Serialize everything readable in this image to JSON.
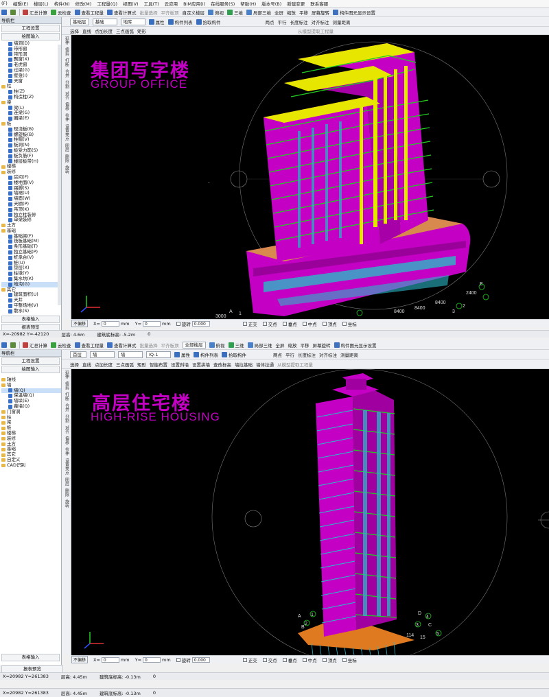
{
  "menu": [
    "(F)",
    "编辑(E)",
    "楼层(L)",
    "构件(N)",
    "修改(M)",
    "工程量(Q)",
    "视图(V)",
    "工具(T)",
    "云应用",
    "BIM应用(I)",
    "在线服务(S)",
    "帮助(H)",
    "版本号(B)",
    "新建变更",
    "联系客服"
  ],
  "panel1": {
    "toolbar1": {
      "calc": "汇总计算",
      "cloud": "云检查",
      "view_qty": "查看工程量",
      "view_formula": "查看计算式",
      "batch": "批量选择",
      "flat": "平齐板顶",
      "custom_floor": "自定义楼层",
      "top_view": "俯视",
      "three_d": "三维",
      "local3d": "局部三维",
      "full_screen": "全屏",
      "zoom": "缩放",
      "pan": "平移",
      "rotate": "屏幕旋转",
      "display": "构件图元显示设置"
    },
    "toolbar2": {
      "floor_label": "基础层",
      "floor_value": "基础",
      "type_value": "地库",
      "attr": "属性",
      "list": "构件列表",
      "pick": "拾取构件",
      "two_point": "两点",
      "parallel": "平行",
      "dim": "长度标注",
      "align": "对齐标注",
      "measure": "测量距离"
    },
    "toolbar3": {
      "select": "选择",
      "line": "直线",
      "add_len": "点加长度",
      "arc": "三点画弧",
      "rect": "矩形",
      "extract": "从模型提取工程量"
    },
    "sidebar": {
      "header": "导航栏",
      "btn1": "工程设置",
      "btn2": "绘图输入",
      "items": [
        {
          "label": "墙洞(D)",
          "lvl": 1
        },
        {
          "label": "带形窗",
          "lvl": 1
        },
        {
          "label": "带形洞",
          "lvl": 1
        },
        {
          "label": "飘窗(X)",
          "lvl": 1
        },
        {
          "label": "老虎窗",
          "lvl": 1
        },
        {
          "label": "过梁(G)",
          "lvl": 1
        },
        {
          "label": "壁龛(I)",
          "lvl": 1
        },
        {
          "label": "天窗",
          "lvl": 1
        },
        {
          "label": "柱",
          "lvl": 0
        },
        {
          "label": "柱(Z)",
          "lvl": 1
        },
        {
          "label": "构造柱(Z)",
          "lvl": 1
        },
        {
          "label": "梁",
          "lvl": 0
        },
        {
          "label": "梁(L)",
          "lvl": 1
        },
        {
          "label": "连梁(G)",
          "lvl": 1
        },
        {
          "label": "圈梁(E)",
          "lvl": 1
        },
        {
          "label": "板",
          "lvl": 0
        },
        {
          "label": "现浇板(B)",
          "lvl": 1
        },
        {
          "label": "螺旋板(B)",
          "lvl": 1
        },
        {
          "label": "柱帽(V)",
          "lvl": 1
        },
        {
          "label": "板洞(N)",
          "lvl": 1
        },
        {
          "label": "板受力筋(S)",
          "lvl": 1
        },
        {
          "label": "板负筋(F)",
          "lvl": 1
        },
        {
          "label": "楼层板带(H)",
          "lvl": 1
        },
        {
          "label": "楼梯",
          "lvl": 0
        },
        {
          "label": "装修",
          "lvl": 0
        },
        {
          "label": "房间(F)",
          "lvl": 1
        },
        {
          "label": "楼地面(V)",
          "lvl": 1
        },
        {
          "label": "踢脚(S)",
          "lvl": 1
        },
        {
          "label": "墙裙(U)",
          "lvl": 1
        },
        {
          "label": "墙面(W)",
          "lvl": 1
        },
        {
          "label": "天棚(P)",
          "lvl": 1
        },
        {
          "label": "吊顶(K)",
          "lvl": 1
        },
        {
          "label": "独立柱装修",
          "lvl": 1
        },
        {
          "label": "单梁装修",
          "lvl": 1
        },
        {
          "label": "土方",
          "lvl": 0
        },
        {
          "label": "基础",
          "lvl": 0
        },
        {
          "label": "基础梁(F)",
          "lvl": 1
        },
        {
          "label": "筏板基础(M)",
          "lvl": 1
        },
        {
          "label": "条形基础(T)",
          "lvl": 1
        },
        {
          "label": "独立基础(P)",
          "lvl": 1
        },
        {
          "label": "桩承台(V)",
          "lvl": 1
        },
        {
          "label": "桩(U)",
          "lvl": 1
        },
        {
          "label": "垫层(X)",
          "lvl": 1
        },
        {
          "label": "柱墩(Y)",
          "lvl": 1
        },
        {
          "label": "集水坑(K)",
          "lvl": 1
        },
        {
          "label": "地沟(G)",
          "lvl": 1,
          "hl": true
        },
        {
          "label": "其它",
          "lvl": 0
        },
        {
          "label": "建筑面积(U)",
          "lvl": 1
        },
        {
          "label": "天井",
          "lvl": 1
        },
        {
          "label": "平整场地(V)",
          "lvl": 1
        },
        {
          "label": "散水(S)",
          "lvl": 1
        }
      ],
      "bottom1": "表格输入",
      "bottom2": "报表预览"
    },
    "vtools": [
      "延伸",
      "修剪",
      "打断",
      "合并",
      "分割",
      "对齐",
      "偏移",
      "拉伸",
      "设置夹点",
      "图层",
      "删除",
      "旋转"
    ],
    "title_cn": "集团写字楼",
    "title_en": "GROUP OFFICE",
    "axis_labels": [
      "2400",
      "8400",
      "8400",
      "8400",
      "3000",
      "E",
      "2",
      "3",
      "A",
      "1"
    ],
    "snap": {
      "no_offset": "不偏移",
      "x": "X=",
      "x_val": "0",
      "mm1": "mm",
      "y": "Y=",
      "y_val": "0",
      "mm2": "mm",
      "rotate": "旋转",
      "rot_val": "0.000",
      "ortho": "正交",
      "cross": "交点",
      "vertical": "垂点",
      "mid": "中点",
      "top": "顶点",
      "coord": "坐标"
    },
    "status": {
      "coords": "X=-20982 Y=-42120",
      "floor_h": "层高: 4.6m",
      "elev": "建筑底标高: -5.2m",
      "zero": "0"
    }
  },
  "panel2": {
    "toolbar1": {
      "calc": "汇总计算",
      "cloud": "云检查",
      "view_qty": "查看工程量",
      "view_formula": "查看计算式",
      "batch": "批量选择",
      "flat": "平齐板顶",
      "all_floor": "全部楼层",
      "top_view": "俯视",
      "three_d": "三维",
      "local3d": "局部三维",
      "full_screen": "全屏",
      "zoom": "缩放",
      "pan": "平移",
      "rotate": "屏幕旋转",
      "display": "构件图元显示设置"
    },
    "toolbar2": {
      "floor_label": "首层",
      "type1": "墙",
      "type2": "墙",
      "type3": "IQ-1",
      "attr": "属性",
      "list": "构件列表",
      "pick": "拾取构件",
      "two_point": "两点",
      "parallel": "平行",
      "dim": "长度标注",
      "align": "对齐标注",
      "measure": "测量距离"
    },
    "toolbar3": {
      "select": "选择",
      "line": "直线",
      "add_len": "点加长度",
      "arc": "三点画弧",
      "rect": "矩形",
      "smart": "智能布置",
      "set_arc": "设置斜墙",
      "set_arch": "设置拱墙",
      "stair": "查改标高",
      "extract_extra": "墙拉基础",
      "extract_parapet": "墙体拉通",
      "extract": "从模型提取工程量"
    },
    "sidebar": {
      "header": "导航栏",
      "btn1": "工程设置",
      "btn2": "绘图输入",
      "items": [
        {
          "label": "轴线",
          "lvl": 0
        },
        {
          "label": "墙",
          "lvl": 0
        },
        {
          "label": "墙(Q)",
          "lvl": 1,
          "hl": true
        },
        {
          "label": "保温墙(Q)",
          "lvl": 1
        },
        {
          "label": "墙垛(E)",
          "lvl": 1
        },
        {
          "label": "幕墙(Q)",
          "lvl": 1
        },
        {
          "label": "门窗洞",
          "lvl": 0
        },
        {
          "label": "柱",
          "lvl": 0
        },
        {
          "label": "梁",
          "lvl": 0
        },
        {
          "label": "板",
          "lvl": 0
        },
        {
          "label": "楼梯",
          "lvl": 0
        },
        {
          "label": "装修",
          "lvl": 0
        },
        {
          "label": "土方",
          "lvl": 0
        },
        {
          "label": "基础",
          "lvl": 0
        },
        {
          "label": "其它",
          "lvl": 0
        },
        {
          "label": "自定义",
          "lvl": 0
        },
        {
          "label": "CAD识别",
          "lvl": 0
        }
      ],
      "bottom1": "表格输入",
      "bottom2": "报表预览"
    },
    "vtools": [
      "延伸",
      "修剪",
      "打断",
      "合并",
      "分割",
      "对齐",
      "偏移",
      "拉伸",
      "设置夹点",
      "图层",
      "删除",
      "旋转"
    ],
    "title_cn": "高层住宅楼",
    "title_en": "HIGH-RISE HOUSING",
    "axis_labels": [
      "1",
      "2",
      "3",
      "4",
      "5",
      "C",
      "D",
      "A",
      "B",
      "114",
      "15"
    ],
    "snap": {
      "no_offset": "不偏移",
      "x": "X=",
      "x_val": "0",
      "mm1": "mm",
      "y": "Y=",
      "y_val": "0",
      "mm2": "mm",
      "rotate": "旋转",
      "rot_val": "0.000",
      "ortho": "正交",
      "cross": "交点",
      "vertical": "垂点",
      "mid": "中点",
      "top": "顶点",
      "coord": "坐标"
    },
    "status": {
      "coords": "X=20982 Y=261383",
      "floor_h": "层高: 4.45m",
      "elev": "建筑底标高: -0.13m",
      "zero": "0"
    }
  },
  "extra_status": {
    "coords": "X=20982 Y=261383",
    "floor_h": "层高: 4.45m",
    "elev": "建筑底标高: -0.13m",
    "zero": "0"
  },
  "colors": {
    "magenta": "#c400c4",
    "yellow": "#e6e600",
    "green": "#22cc22",
    "cyan": "#2ab8c8",
    "orange": "#e07a20"
  }
}
